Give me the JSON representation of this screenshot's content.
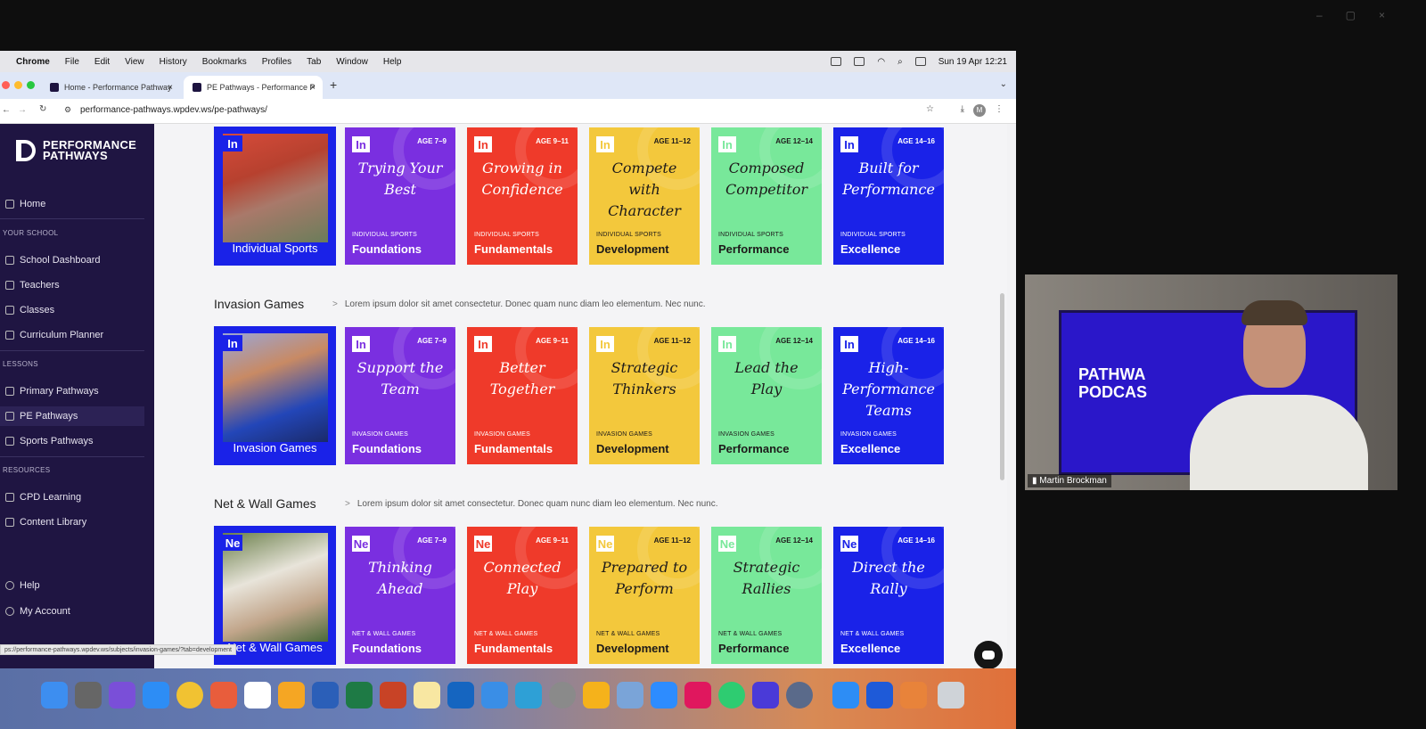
{
  "menubar": {
    "app": "Chrome",
    "items": [
      "File",
      "Edit",
      "View",
      "History",
      "Bookmarks",
      "Profiles",
      "Tab",
      "Window",
      "Help"
    ],
    "clock": "Sun 19 Apr 12:21"
  },
  "tabs": [
    {
      "title": "Home - Performance Pathway"
    },
    {
      "title": "PE Pathways - Performance P"
    }
  ],
  "toolbar": {
    "url": "performance-pathways.wpdev.ws/pe-pathways/"
  },
  "sidebar": {
    "logo_line1": "PERFORMANCE",
    "logo_line2": "PATHWAYS",
    "home": "Home",
    "section_school": "YOUR SCHOOL",
    "school_items": [
      "School Dashboard",
      "Teachers",
      "Classes",
      "Curriculum Planner"
    ],
    "section_lessons": "LESSONS",
    "lesson_items": [
      "Primary Pathways",
      "PE Pathways",
      "Sports Pathways"
    ],
    "section_resources": "RESOURCES",
    "resource_items": [
      "CPD Learning",
      "Content Library"
    ],
    "help": "Help",
    "account": "My Account"
  },
  "rows": [
    {
      "title": "",
      "desc": "",
      "photo_label": "Individual Sports",
      "badge": "In",
      "category": "INDIVIDUAL SPORTS",
      "cards": [
        {
          "badge": "In",
          "age": "AGE 7–9",
          "title_lines": [
            "Trying Your",
            "Best"
          ],
          "level": "Foundations"
        },
        {
          "badge": "In",
          "age": "AGE 9–11",
          "title_lines": [
            "Growing in",
            "Confidence"
          ],
          "level": "Fundamentals"
        },
        {
          "badge": "In",
          "age": "AGE 11–12",
          "title_lines": [
            "Compete",
            "with",
            "Character"
          ],
          "level": "Development"
        },
        {
          "badge": "In",
          "age": "AGE 12–14",
          "title_lines": [
            "Composed",
            "Competitor"
          ],
          "level": "Performance"
        },
        {
          "badge": "In",
          "age": "AGE 14–16",
          "title_lines": [
            "Built for",
            "Performance"
          ],
          "level": "Excellence"
        }
      ]
    },
    {
      "title": "Invasion Games",
      "desc": "Lorem ipsum dolor sit amet consectetur. Donec quam nunc diam leo elementum. Nec nunc.",
      "photo_label": "Invasion Games",
      "badge": "In",
      "category": "INVASION GAMES",
      "cards": [
        {
          "badge": "In",
          "age": "AGE 7–9",
          "title_lines": [
            "Support the",
            "Team"
          ],
          "level": "Foundations"
        },
        {
          "badge": "In",
          "age": "AGE 9–11",
          "title_lines": [
            "Better",
            "Together"
          ],
          "level": "Fundamentals"
        },
        {
          "badge": "In",
          "age": "AGE 11–12",
          "title_lines": [
            "Strategic",
            "Thinkers"
          ],
          "level": "Development"
        },
        {
          "badge": "In",
          "age": "AGE 12–14",
          "title_lines": [
            "Lead the",
            "Play"
          ],
          "level": "Performance"
        },
        {
          "badge": "In",
          "age": "AGE 14–16",
          "title_lines": [
            "High-",
            "Performance",
            "Teams"
          ],
          "level": "Excellence"
        }
      ]
    },
    {
      "title": "Net & Wall Games",
      "desc": "Lorem ipsum dolor sit amet consectetur. Donec quam nunc diam leo elementum. Nec nunc.",
      "photo_label": "Net & Wall Games",
      "badge": "Ne",
      "category": "NET & WALL GAMES",
      "cards": [
        {
          "badge": "Ne",
          "age": "AGE 7–9",
          "title_lines": [
            "Thinking",
            "Ahead"
          ],
          "level": "Foundations"
        },
        {
          "badge": "Ne",
          "age": "AGE 9–11",
          "title_lines": [
            "Connected",
            "Play"
          ],
          "level": "Fundamentals"
        },
        {
          "badge": "Ne",
          "age": "AGE 11–12",
          "title_lines": [
            "Prepared to",
            "Perform"
          ],
          "level": "Development"
        },
        {
          "badge": "Ne",
          "age": "AGE 12–14",
          "title_lines": [
            "Strategic",
            "Rallies"
          ],
          "level": "Performance"
        },
        {
          "badge": "Ne",
          "age": "AGE 14–16",
          "title_lines": [
            "Direct the",
            "Rally"
          ],
          "level": "Excellence"
        }
      ]
    }
  ],
  "card_colors": [
    "#7a2fe0",
    "#ef3a2a",
    "#f3c83c",
    "#78e89a",
    "#1a22e8"
  ],
  "status_url": "ps://performance-pathways.wpdev.ws/subjects/invasion-games/?tab=development",
  "video": {
    "logo_line1": "PATHWA",
    "logo_line2": "PODCAS",
    "participant": "Martin Brockman"
  }
}
